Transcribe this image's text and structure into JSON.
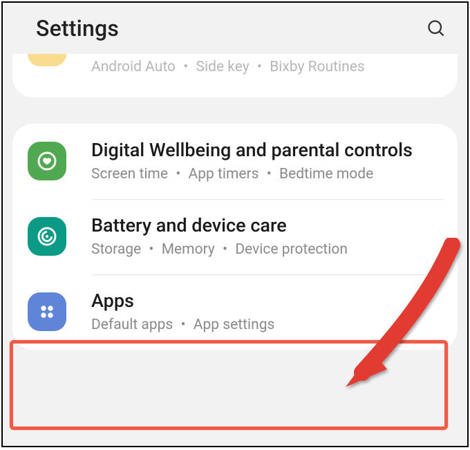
{
  "header": {
    "title": "Settings"
  },
  "cutoff_row": {
    "sub_parts": [
      "Android Auto",
      "Side key",
      "Bixby Routines"
    ]
  },
  "rows": [
    {
      "key": "wellbeing",
      "title": "Digital Wellbeing and parental controls",
      "sub_parts": [
        "Screen time",
        "App timers",
        "Bedtime mode"
      ]
    },
    {
      "key": "battery",
      "title": "Battery and device care",
      "sub_parts": [
        "Storage",
        "Memory",
        "Device protection"
      ]
    },
    {
      "key": "apps",
      "title": "Apps",
      "sub_parts": [
        "Default apps",
        "App settings"
      ]
    }
  ],
  "sep": "•"
}
